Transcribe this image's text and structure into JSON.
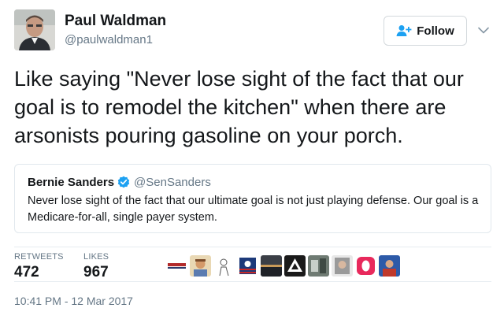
{
  "colors": {
    "text": "#14171a",
    "muted": "#657786",
    "accent": "#1da1f2",
    "border": "#e1e8ed"
  },
  "author": {
    "name": "Paul Waldman",
    "handle": "@paulwaldman1",
    "avatar_icon": "avatar-photo"
  },
  "follow": {
    "label": "Follow",
    "icon": "add-user-icon",
    "menu_icon": "chevron-down-icon"
  },
  "tweet": {
    "text": "Like saying \"Never lose sight of the fact that our goal is to remodel the kitchen\" when there are arsonists pouring gasoline on your porch."
  },
  "quoted": {
    "name": "Bernie Sanders",
    "verified_icon": "verified-badge-icon",
    "handle": "@SenSanders",
    "text": "Never lose sight of the fact that our ultimate goal is not just playing defense. Our goal is a Medicare-for-all, single payer system."
  },
  "stats": {
    "retweets_label": "RETWEETS",
    "retweets_value": "472",
    "likes_label": "LIKES",
    "likes_value": "967"
  },
  "liker_avatars": [
    "liker-avatar-1",
    "liker-avatar-2",
    "liker-avatar-3",
    "liker-avatar-4",
    "liker-avatar-5",
    "liker-avatar-6",
    "liker-avatar-7",
    "liker-avatar-8",
    "liker-avatar-9",
    "liker-avatar-10"
  ],
  "timestamp": "10:41 PM - 12 Mar 2017"
}
